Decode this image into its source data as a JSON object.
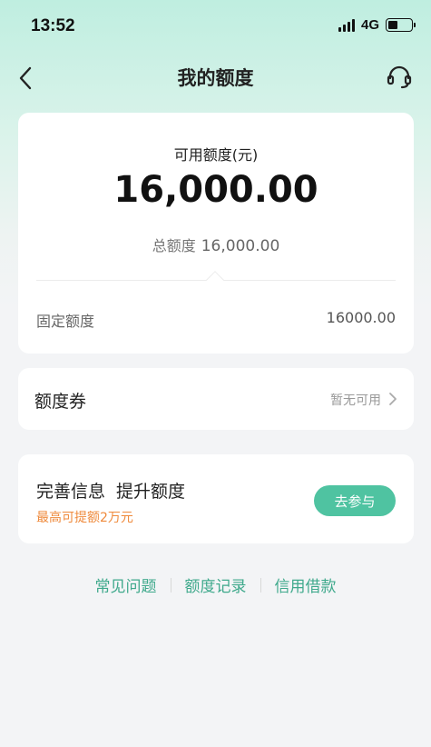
{
  "status_bar": {
    "time": "13:52",
    "network": "4G",
    "signal_icon": "cellular-signal-icon",
    "battery_icon": "battery-icon",
    "battery_level": 0.4
  },
  "nav": {
    "title": "我的额度",
    "back_icon": "back-arrow-icon",
    "support_icon": "headset-support-icon"
  },
  "credit": {
    "available_label": "可用额度(元)",
    "available_value": "16,000.00",
    "total_label": "总额度",
    "total_value": "16,000.00",
    "fixed_label": "固定额度",
    "fixed_value": "16000.00"
  },
  "coupon": {
    "label": "额度券",
    "status": "暂无可用",
    "chevron_icon": "chevron-right-icon"
  },
  "promo": {
    "title": "完善信息 提升额度",
    "subtitle": "最高可提额2万元",
    "button_label": "去参与",
    "accent_color": "#4fc3a1",
    "subtitle_color": "#ef8a3c"
  },
  "links": {
    "faq": "常见问题",
    "records": "额度记录",
    "loan": "信用借款",
    "link_color": "#3fa98c"
  }
}
